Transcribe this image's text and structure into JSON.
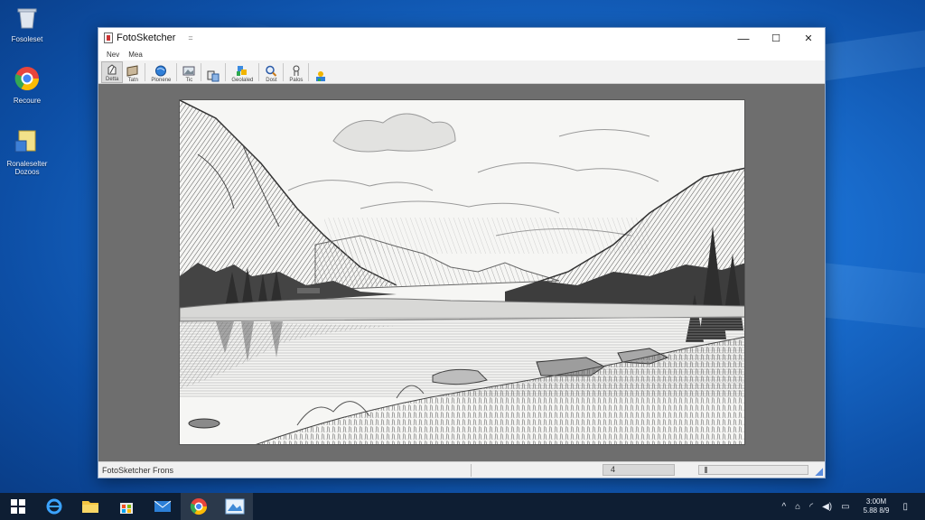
{
  "desktop": {
    "icons": [
      {
        "label": "Fosoleset"
      },
      {
        "label": "Recoure"
      },
      {
        "label": "Ronaleselter\nDozoos"
      }
    ]
  },
  "window": {
    "title": "FotoSketcher",
    "title_extra": "=",
    "controls": {
      "minimize": "—",
      "maximize": "☐",
      "close": "✕"
    }
  },
  "menu": [
    {
      "label": "Nev"
    },
    {
      "label": "Mea"
    }
  ],
  "toolbar": [
    {
      "label": "Detta",
      "icon": "pencil-icon"
    },
    {
      "label": "Tatn",
      "icon": "sketch-icon"
    },
    {
      "label": "Plonene",
      "icon": "globe-icon"
    },
    {
      "label": "Tic",
      "icon": "picture-icon"
    },
    {
      "label": "",
      "icon": "compare-icon"
    },
    {
      "label": "Geolaled",
      "icon": "palette-icon"
    },
    {
      "label": "Dost",
      "icon": "zoom-icon"
    },
    {
      "label": "Palos",
      "icon": "person-icon"
    },
    {
      "label": "",
      "icon": "layers-icon"
    }
  ],
  "status": {
    "text": "FotoSketcher Frons",
    "zoom_value": "4"
  },
  "taskbar": {
    "apps": [
      "windows-start-icon",
      "internet-explorer-icon",
      "file-explorer-icon",
      "store-icon",
      "mail-icon",
      "chrome-icon",
      "fotosketcher-icon"
    ],
    "clock_time": "3:00M",
    "clock_date": "5.88 8/9"
  },
  "colors": {
    "desktop_blue": "#1a6fd1",
    "workspace_gray": "#6e6e6e",
    "taskbar": "#0e1e33"
  }
}
